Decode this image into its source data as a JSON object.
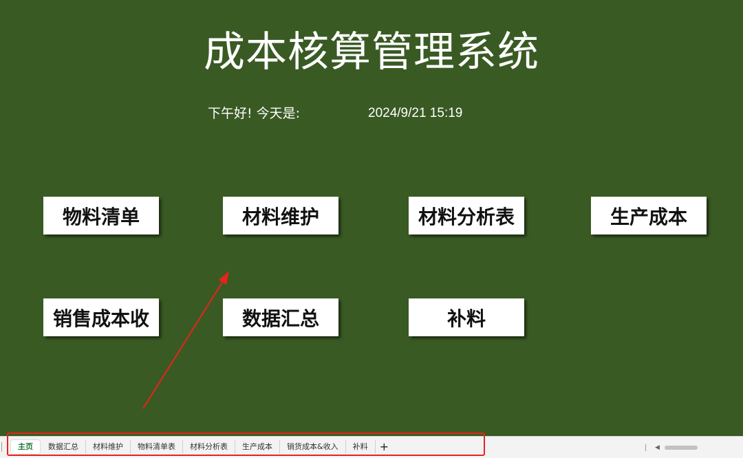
{
  "title": "成本核算管理系统",
  "greeting": {
    "label": "下午好! 今天是:",
    "datetime": "2024/9/21 15:19"
  },
  "buttons": {
    "materials_list": "物料清单",
    "material_maintenance": "材料维护",
    "material_analysis": "材料分析表",
    "production_cost": "生产成本",
    "sales_cost_income": "销售成本收",
    "data_summary": "数据汇总",
    "supplementary_material": "补料"
  },
  "tabs": [
    {
      "label": "主页",
      "active": true
    },
    {
      "label": "数据汇总",
      "active": false
    },
    {
      "label": "材料维护",
      "active": false
    },
    {
      "label": "物料清单表",
      "active": false
    },
    {
      "label": "材料分析表",
      "active": false
    },
    {
      "label": "生产成本",
      "active": false
    },
    {
      "label": "销货成本&收入",
      "active": false
    },
    {
      "label": "补料",
      "active": false
    }
  ],
  "add_tab_icon": "+",
  "colors": {
    "background": "#3a5a24",
    "button_bg": "#ffffff",
    "active_tab_text": "#1e7a3a",
    "annotation": "#e8231b"
  },
  "icons": {
    "add_tab": "plus-icon",
    "scroll_left": "chevron-left-icon",
    "annotation_arrow": "arrow-icon"
  }
}
